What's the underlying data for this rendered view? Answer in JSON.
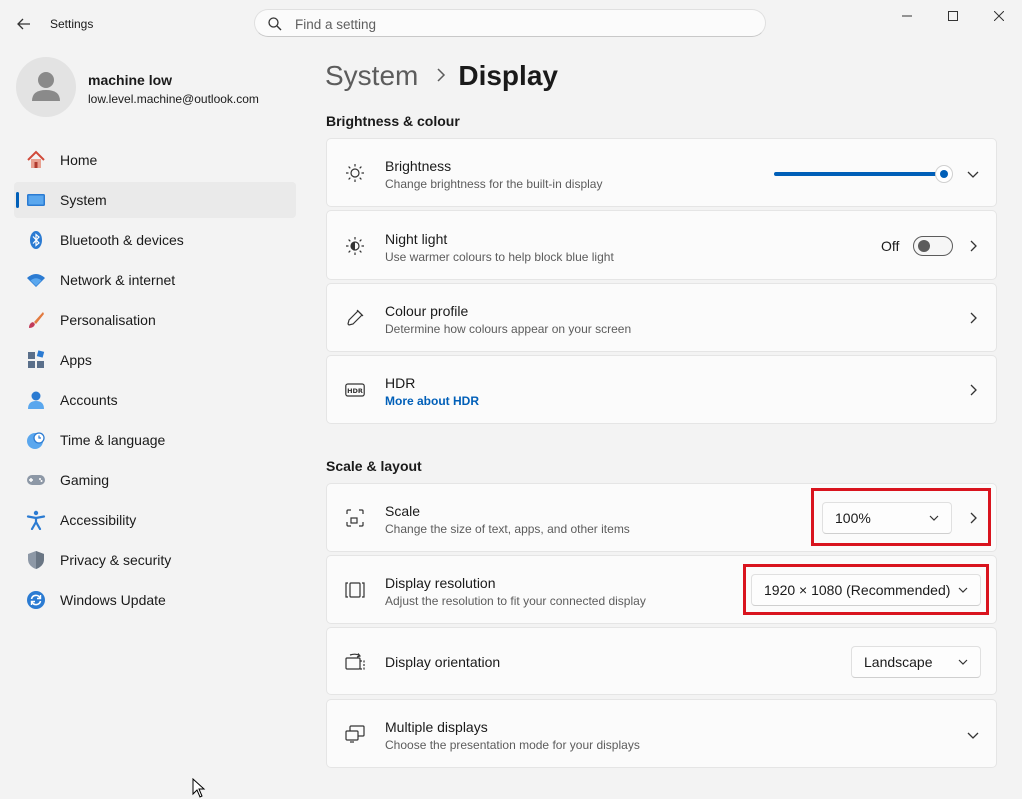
{
  "window": {
    "app_title": "Settings",
    "search_placeholder": "Find a setting"
  },
  "profile": {
    "name": "machine low",
    "email": "low.level.machine@outlook.com"
  },
  "nav": {
    "items": [
      {
        "label": "Home",
        "icon": "home-icon"
      },
      {
        "label": "System",
        "icon": "system-icon",
        "active": true
      },
      {
        "label": "Bluetooth & devices",
        "icon": "bluetooth-icon"
      },
      {
        "label": "Network & internet",
        "icon": "wifi-icon"
      },
      {
        "label": "Personalisation",
        "icon": "brush-icon"
      },
      {
        "label": "Apps",
        "icon": "apps-icon"
      },
      {
        "label": "Accounts",
        "icon": "account-icon"
      },
      {
        "label": "Time & language",
        "icon": "clock-globe-icon"
      },
      {
        "label": "Gaming",
        "icon": "gamepad-icon"
      },
      {
        "label": "Accessibility",
        "icon": "accessibility-icon"
      },
      {
        "label": "Privacy & security",
        "icon": "shield-icon"
      },
      {
        "label": "Windows Update",
        "icon": "update-icon"
      }
    ]
  },
  "breadcrumb": {
    "parent": "System",
    "current": "Display"
  },
  "sections": {
    "brightness_colour": "Brightness & colour",
    "scale_layout": "Scale & layout"
  },
  "brightness": {
    "title": "Brightness",
    "subtitle": "Change brightness for the built-in display",
    "level": 1.0
  },
  "night_light": {
    "title": "Night light",
    "subtitle": "Use warmer colours to help block blue light",
    "state": "Off"
  },
  "colour_profile": {
    "title": "Colour profile",
    "subtitle": "Determine how colours appear on your screen"
  },
  "hdr": {
    "title": "HDR",
    "link": "More about HDR"
  },
  "scale": {
    "title": "Scale",
    "subtitle": "Change the size of text, apps, and other items",
    "value": "100%"
  },
  "resolution": {
    "title": "Display resolution",
    "subtitle": "Adjust the resolution to fit your connected display",
    "value": "1920 × 1080 (Recommended)"
  },
  "orientation": {
    "title": "Display orientation",
    "value": "Landscape"
  },
  "multiple_displays": {
    "title": "Multiple displays",
    "subtitle": "Choose the presentation mode for your displays"
  },
  "colors": {
    "accent": "#005fb8",
    "highlight": "#d9141e"
  }
}
